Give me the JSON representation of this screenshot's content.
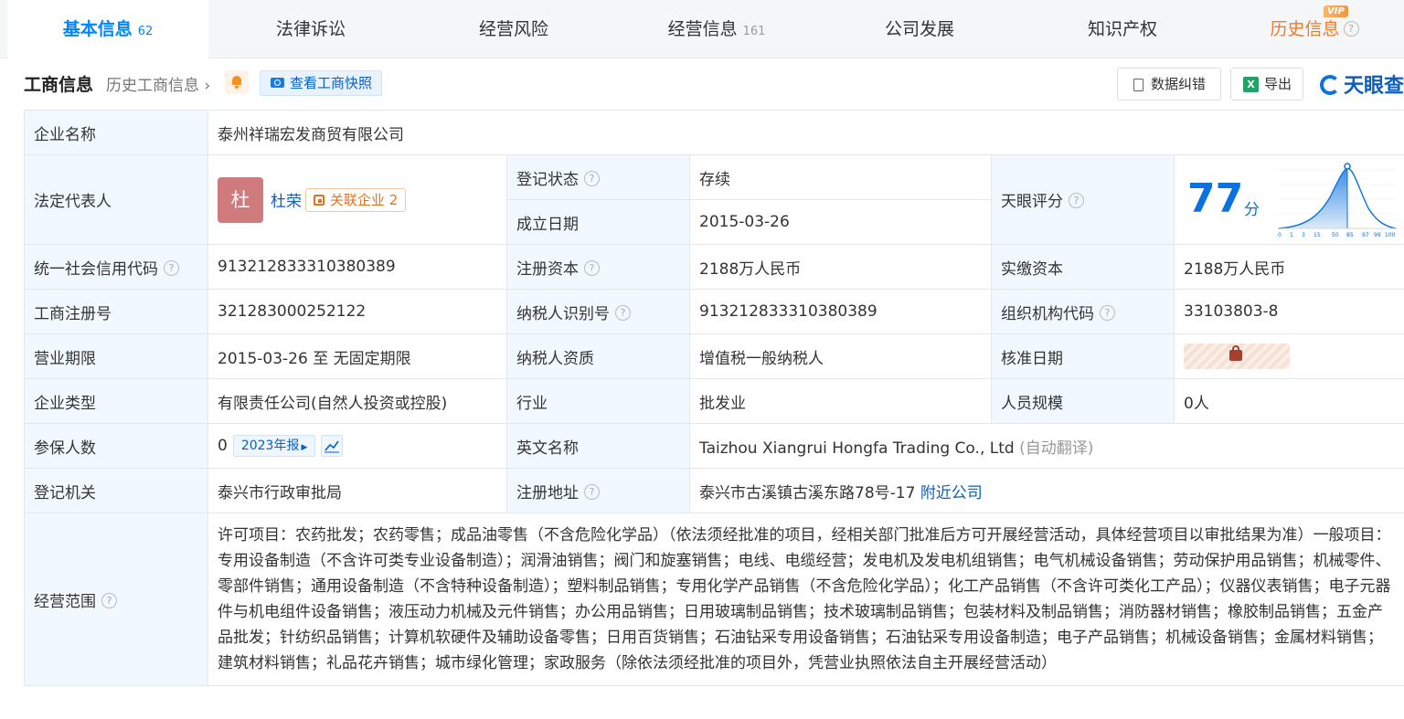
{
  "tabs": [
    {
      "label": "基本信息",
      "count": "62"
    },
    {
      "label": "法律诉讼",
      "count": ""
    },
    {
      "label": "经营风险",
      "count": ""
    },
    {
      "label": "经营信息",
      "count": "161"
    },
    {
      "label": "公司发展",
      "count": ""
    },
    {
      "label": "知识产权",
      "count": ""
    },
    {
      "label": "历史信息",
      "count": "",
      "badge": "VIP"
    }
  ],
  "header": {
    "title": "工商信息",
    "history_link": "历史工商信息",
    "snapshot_btn": "查看工商快照",
    "correct_btn": "数据纠错",
    "export_btn": "导出",
    "brand": "天眼查",
    "qmark": "?"
  },
  "info": {
    "company_name_label": "企业名称",
    "company_name": "泰州祥瑞宏发商贸有限公司",
    "legal_rep_label": "法定代表人",
    "legal_rep_avatar": "杜",
    "legal_rep_name": "杜荣",
    "related_label": "关联企业",
    "related_count": "2",
    "reg_status_label": "登记状态",
    "reg_status": "存续",
    "found_date_label": "成立日期",
    "found_date": "2015-03-26",
    "score_label": "天眼评分",
    "score": "77",
    "score_unit": "分",
    "score_axis": [
      "0",
      "1",
      "3",
      "15",
      "50",
      "85",
      "97",
      "99",
      "100"
    ],
    "credit_code_label": "统一社会信用代码",
    "credit_code": "913212833310380389",
    "reg_capital_label": "注册资本",
    "reg_capital": "2188万人民币",
    "paid_capital_label": "实缴资本",
    "paid_capital": "2188万人民币",
    "reg_no_label": "工商注册号",
    "reg_no": "321283000252122",
    "taxpayer_id_label": "纳税人识别号",
    "taxpayer_id": "913212833310380389",
    "org_code_label": "组织机构代码",
    "org_code": "33103803-8",
    "term_label": "营业期限",
    "term": "2015-03-26 至 无固定期限",
    "taxpayer_type_label": "纳税人资质",
    "taxpayer_type": "增值税一般纳税人",
    "approve_date_label": "核准日期",
    "company_type_label": "企业类型",
    "company_type": "有限责任公司(自然人投资或控股)",
    "industry_label": "行业",
    "industry": "批发业",
    "staff_label": "人员规模",
    "staff": "0人",
    "insured_label": "参保人数",
    "insured": "0",
    "report_badge": "2023年报",
    "en_name_label": "英文名称",
    "en_name": "Taizhou Xiangrui Hongfa Trading Co., Ltd",
    "en_auto": "(自动翻译)",
    "authority_label": "登记机关",
    "authority": "泰兴市行政审批局",
    "address_label": "注册地址",
    "address": "泰兴市古溪镇古溪东路78号-17",
    "nearby": "附近公司",
    "scope_label": "经营范围",
    "scope": "许可项目：农药批发；农药零售；成品油零售（不含危险化学品）（依法须经批准的项目，经相关部门批准后方可开展经营活动，具体经营项目以审批结果为准）一般项目：专用设备制造（不含许可类专业设备制造）；润滑油销售；阀门和旋塞销售；电线、电缆经营；发电机及发电机组销售；电气机械设备销售；劳动保护用品销售；机械零件、零部件销售；通用设备制造（不含特种设备制造）；塑料制品销售；专用化学产品销售（不含危险化学品）；化工产品销售（不含许可类化工产品）；仪器仪表销售；电子元器件与机电组件设备销售；液压动力机械及元件销售；办公用品销售；日用玻璃制品销售；技术玻璃制品销售；包装材料及制品销售；消防器材销售；橡胶制品销售；五金产品批发；针纺织品销售；计算机软硬件及辅助设备零售；日用百货销售；石油钻采专用设备销售；石油钻采专用设备制造；电子产品销售；机械设备销售；金属材料销售；建筑材料销售；礼品花卉销售；城市绿化管理；家政服务（除依法须经批准的项目外，凭营业执照依法自主开展经营活动）"
  }
}
